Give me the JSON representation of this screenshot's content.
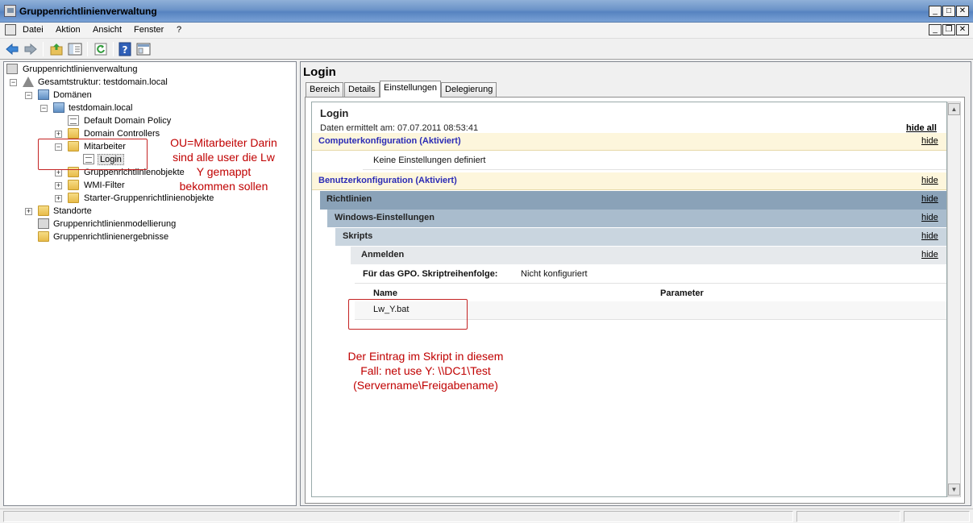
{
  "window": {
    "title": "Gruppenrichtlinienverwaltung"
  },
  "menu": {
    "items": [
      "Datei",
      "Aktion",
      "Ansicht",
      "Fenster",
      "?"
    ]
  },
  "toolbar": {
    "buttons": [
      "back-icon",
      "forward-icon",
      "up-folder-icon",
      "show-tree-icon",
      "refresh-icon",
      "help-icon",
      "properties-icon"
    ]
  },
  "tree": {
    "root": "Gruppenrichtlinienverwaltung",
    "forest": "Gesamtstruktur: testdomain.local",
    "domains": "Domänen",
    "domain": "testdomain.local",
    "default_policy": "Default Domain Policy",
    "domain_controllers": "Domain Controllers",
    "ou": "Mitarbeiter",
    "gpo_link": "Login",
    "gpo_objects": "Gruppenrichtlinienobjekte",
    "wmi_filter": "WMI-Filter",
    "starter_gpo": "Starter-Gruppenrichtlinienobjekte",
    "sites": "Standorte",
    "modeling": "Gruppenrichtlinienmodellierung",
    "results": "Gruppenrichtlinienergebnisse"
  },
  "right": {
    "title": "Login",
    "tabs": [
      "Bereich",
      "Details",
      "Einstellungen",
      "Delegierung"
    ],
    "active_tab": "Einstellungen"
  },
  "report": {
    "title": "Login",
    "date": "Daten ermittelt am: 07.07.2011 08:53:41",
    "hide_all": "hide all",
    "hide": "hide",
    "computer_config": "Computerkonfiguration (Aktiviert)",
    "no_settings": "Keine Einstellungen definiert",
    "user_config": "Benutzerkonfiguration (Aktiviert)",
    "policies": "Richtlinien",
    "windows_settings": "Windows-Einstellungen",
    "scripts": "Skripts",
    "logon": "Anmelden",
    "order_label": "Für das GPO. Skriptreihenfolge:",
    "order_value": "Nicht konfiguriert",
    "col_name": "Name",
    "col_params": "Parameter",
    "script_name": "Lw_Y.bat"
  },
  "annotations": {
    "ou_note": [
      "OU=Mitarbeiter Darin",
      "sind alle user die Lw",
      "Y gemappt",
      "bekommen sollen"
    ],
    "script_note": [
      "Der Eintrag im Skript in diesem",
      "Fall: net use Y: \\\\DC1\\Test",
      "(Servername\\Freigabename)"
    ],
    "color": "#c00000"
  }
}
